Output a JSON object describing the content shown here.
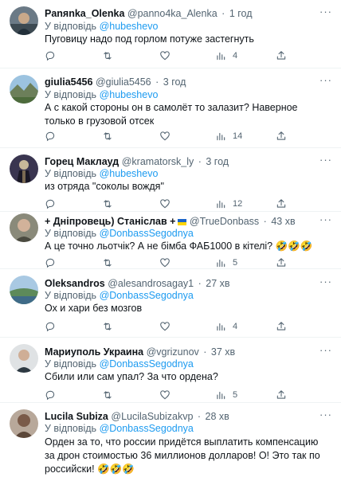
{
  "colors": {
    "accent": "#1d9bf0",
    "muted": "#536471",
    "text": "#0f1419",
    "divider": "#eff3f4"
  },
  "reply_prefix": "У відповідь",
  "icons": {
    "reply": "speech-bubble-icon",
    "retweet": "retweet-icon",
    "views": "bar-chart-icon",
    "share": "share-icon",
    "more": "more-dots-icon"
  },
  "tweets": [
    {
      "name": "Panяnka_Olenka",
      "handle": "@panno4ka_Alenka",
      "time": "1 год",
      "reply_to": "@hubeshevo",
      "text": "Пуговицу надо под горлом потуже застегнуть",
      "replies": "",
      "retweets": "",
      "likes": "",
      "views": "4"
    },
    {
      "name": "giulia5456",
      "handle": "@giulia5456",
      "time": "3 год",
      "reply_to": "@hubeshevo",
      "text": "А с какой стороны он в самолёт то залазит? Наверное только в грузовой отсек",
      "replies": "",
      "retweets": "",
      "likes": "",
      "views": "14"
    },
    {
      "name": "Горец Маклауд",
      "handle": "@kramatorsk_ly",
      "time": "3 год",
      "reply_to": "@hubeshevo",
      "text": "из отряда \"соколы вождя\"",
      "replies": "",
      "retweets": "",
      "likes": "",
      "views": "12"
    },
    {
      "name": "+ Дніпровець) Станіслав +",
      "handle": "@TrueDonbass",
      "time": "43 хв",
      "reply_to": "@DonbassSegodnya",
      "text": "А це точно льотчік? А не бімба ФАБ1000 в кітелі? 🤣🤣🤣",
      "replies": "",
      "retweets": "",
      "likes": "",
      "views": "5"
    },
    {
      "name": "Oleksandros",
      "handle": "@alesandrosagay1",
      "time": "27 хв",
      "reply_to": "@DonbassSegodnya",
      "text": "Ох и хари без мозгов",
      "replies": "",
      "retweets": "",
      "likes": "",
      "views": "4"
    },
    {
      "name": "Мариуполь Украина",
      "handle": "@vgrizunov",
      "time": "37 хв",
      "reply_to": "@DonbassSegodnya",
      "text": "Сбили или сам упал? За что ордена?",
      "replies": "",
      "retweets": "",
      "likes": "",
      "views": "5"
    },
    {
      "name": "Lucila Subiza",
      "handle": "@LucilaSubizakvp",
      "time": "28 хв",
      "reply_to": "@DonbassSegodnya",
      "text": "Орден за то, что россии придётся выплатить компенсацию за дрон стоимостью 36 миллионов долларов! О! Это так по российски! 🤣🤣🤣",
      "replies": "",
      "retweets": "",
      "likes": "",
      "views": ""
    }
  ]
}
